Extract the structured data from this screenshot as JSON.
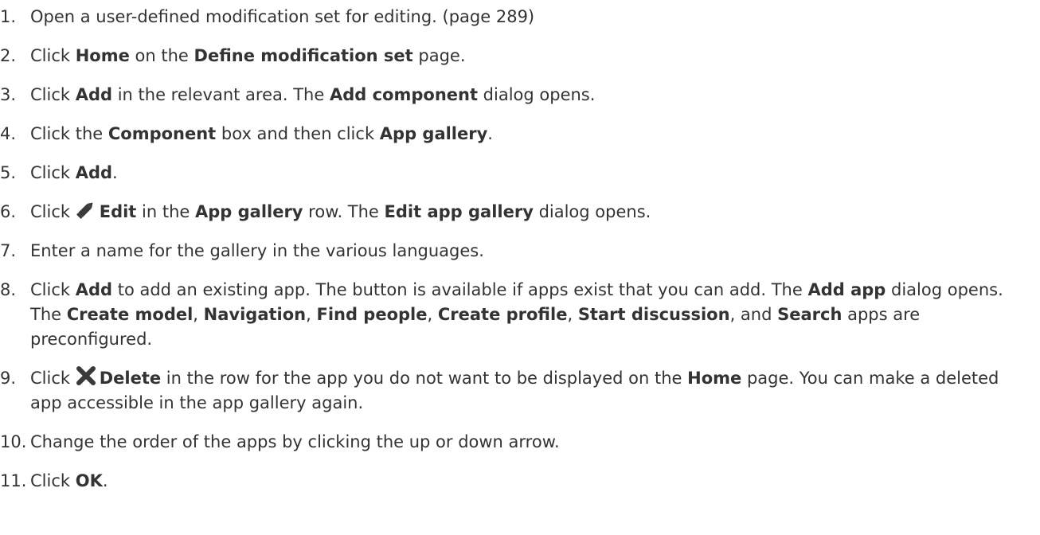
{
  "steps": [
    {
      "number": "1.",
      "parts": [
        {
          "t": "Open a user-defined modification set for editing. (page 289)"
        }
      ]
    },
    {
      "number": "2.",
      "parts": [
        {
          "t": "Click "
        },
        {
          "b": "Home"
        },
        {
          "t": " on the "
        },
        {
          "b": "Define modification set"
        },
        {
          "t": " page."
        }
      ]
    },
    {
      "number": "3.",
      "parts": [
        {
          "t": "Click "
        },
        {
          "b": "Add"
        },
        {
          "t": " in the relevant area. The "
        },
        {
          "b": "Add component"
        },
        {
          "t": " dialog opens."
        }
      ]
    },
    {
      "number": "4.",
      "parts": [
        {
          "t": "Click the "
        },
        {
          "b": "Component"
        },
        {
          "t": " box and then click "
        },
        {
          "b": "App gallery"
        },
        {
          "t": "."
        }
      ]
    },
    {
      "number": "5.",
      "parts": [
        {
          "t": "Click "
        },
        {
          "b": "Add"
        },
        {
          "t": "."
        }
      ]
    },
    {
      "number": "6.",
      "parts": [
        {
          "t": "Click "
        },
        {
          "icon": "pencil-icon"
        },
        {
          "b": "Edit"
        },
        {
          "t": " in the "
        },
        {
          "b": "App gallery"
        },
        {
          "t": " row. The "
        },
        {
          "b": "Edit app gallery"
        },
        {
          "t": " dialog opens."
        }
      ]
    },
    {
      "number": "7.",
      "parts": [
        {
          "t": "Enter a name for the gallery in the various languages."
        }
      ]
    },
    {
      "number": "8.",
      "parts": [
        {
          "t": "Click "
        },
        {
          "b": "Add"
        },
        {
          "t": " to add an existing app. The button is available if apps exist that you can add. The "
        },
        {
          "b": "Add app"
        },
        {
          "t": " dialog opens. The "
        },
        {
          "b": "Create model"
        },
        {
          "t": ", "
        },
        {
          "b": "Navigation"
        },
        {
          "t": ", "
        },
        {
          "b": "Find people"
        },
        {
          "t": ", "
        },
        {
          "b": "Create profile"
        },
        {
          "t": ", "
        },
        {
          "b": "Start discussion"
        },
        {
          "t": ", and "
        },
        {
          "b": "Search"
        },
        {
          "t": " apps are preconfigured."
        }
      ]
    },
    {
      "number": "9.",
      "parts": [
        {
          "t": "Click "
        },
        {
          "icon": "delete-x-icon"
        },
        {
          "b": "Delete"
        },
        {
          "t": " in the row for the app you do not want to be displayed on the "
        },
        {
          "b": "Home"
        },
        {
          "t": " page. You can make a deleted app accessible in the app gallery again."
        }
      ]
    },
    {
      "number": "10.",
      "parts": [
        {
          "t": "Change the order of the apps by clicking the up or down arrow."
        }
      ]
    },
    {
      "number": "11.",
      "parts": [
        {
          "t": "Click "
        },
        {
          "b": "OK"
        },
        {
          "t": "."
        }
      ]
    }
  ],
  "colors": {
    "text": "#333333",
    "icon": "#3a3a3a"
  }
}
